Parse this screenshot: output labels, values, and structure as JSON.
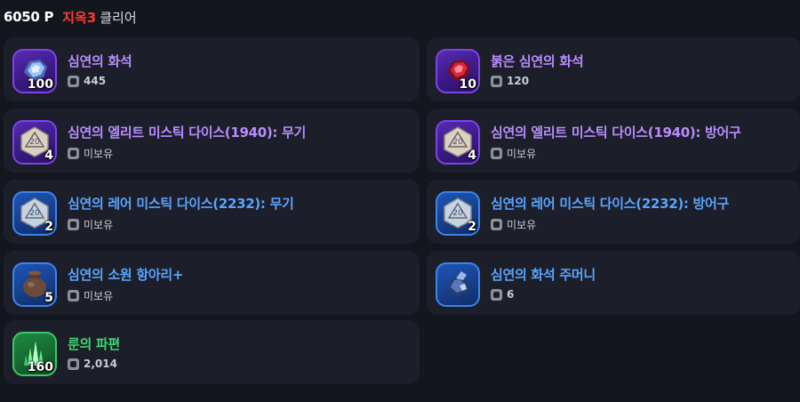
{
  "header": {
    "points": "6050 P",
    "difficulty": "지옥3",
    "status": "클리어"
  },
  "items": [
    {
      "name": "심연의 화석",
      "qty": "100",
      "owned": "445",
      "rarity": "purple",
      "icon": "abyss-fossil-icon"
    },
    {
      "name": "붉은 심연의 화석",
      "qty": "10",
      "owned": "120",
      "rarity": "purple",
      "icon": "red-abyss-fossil-icon"
    },
    {
      "name": "심연의 엘리트 미스틱 다이스(1940): 무기",
      "qty": "4",
      "owned": "미보유",
      "rarity": "purple",
      "icon": "elite-dice-icon"
    },
    {
      "name": "심연의 엘리트 미스틱 다이스(1940): 방어구",
      "qty": "4",
      "owned": "미보유",
      "rarity": "purple",
      "icon": "elite-dice-icon"
    },
    {
      "name": "심연의 레어 미스틱 다이스(2232): 무기",
      "qty": "2",
      "owned": "미보유",
      "rarity": "blue",
      "icon": "rare-dice-icon"
    },
    {
      "name": "심연의 레어 미스틱 다이스(2232): 방어구",
      "qty": "2",
      "owned": "미보유",
      "rarity": "blue",
      "icon": "rare-dice-icon"
    },
    {
      "name": "심연의 소원 항아리+",
      "qty": "5",
      "owned": "미보유",
      "rarity": "blue",
      "icon": "wish-jar-icon"
    },
    {
      "name": "심연의 화석 주머니",
      "qty": "",
      "owned": "6",
      "rarity": "blue",
      "icon": "fossil-pouch-icon"
    },
    {
      "name": "룬의 파편",
      "qty": "160",
      "owned": "2,014",
      "rarity": "green",
      "icon": "rune-shard-icon"
    }
  ],
  "colors": {
    "background": "#14161e",
    "card": "#1c1f29",
    "purple": "#b98cff",
    "blue": "#5aa3ff",
    "green": "#3fd56f",
    "difficulty": "#ff3b30"
  }
}
